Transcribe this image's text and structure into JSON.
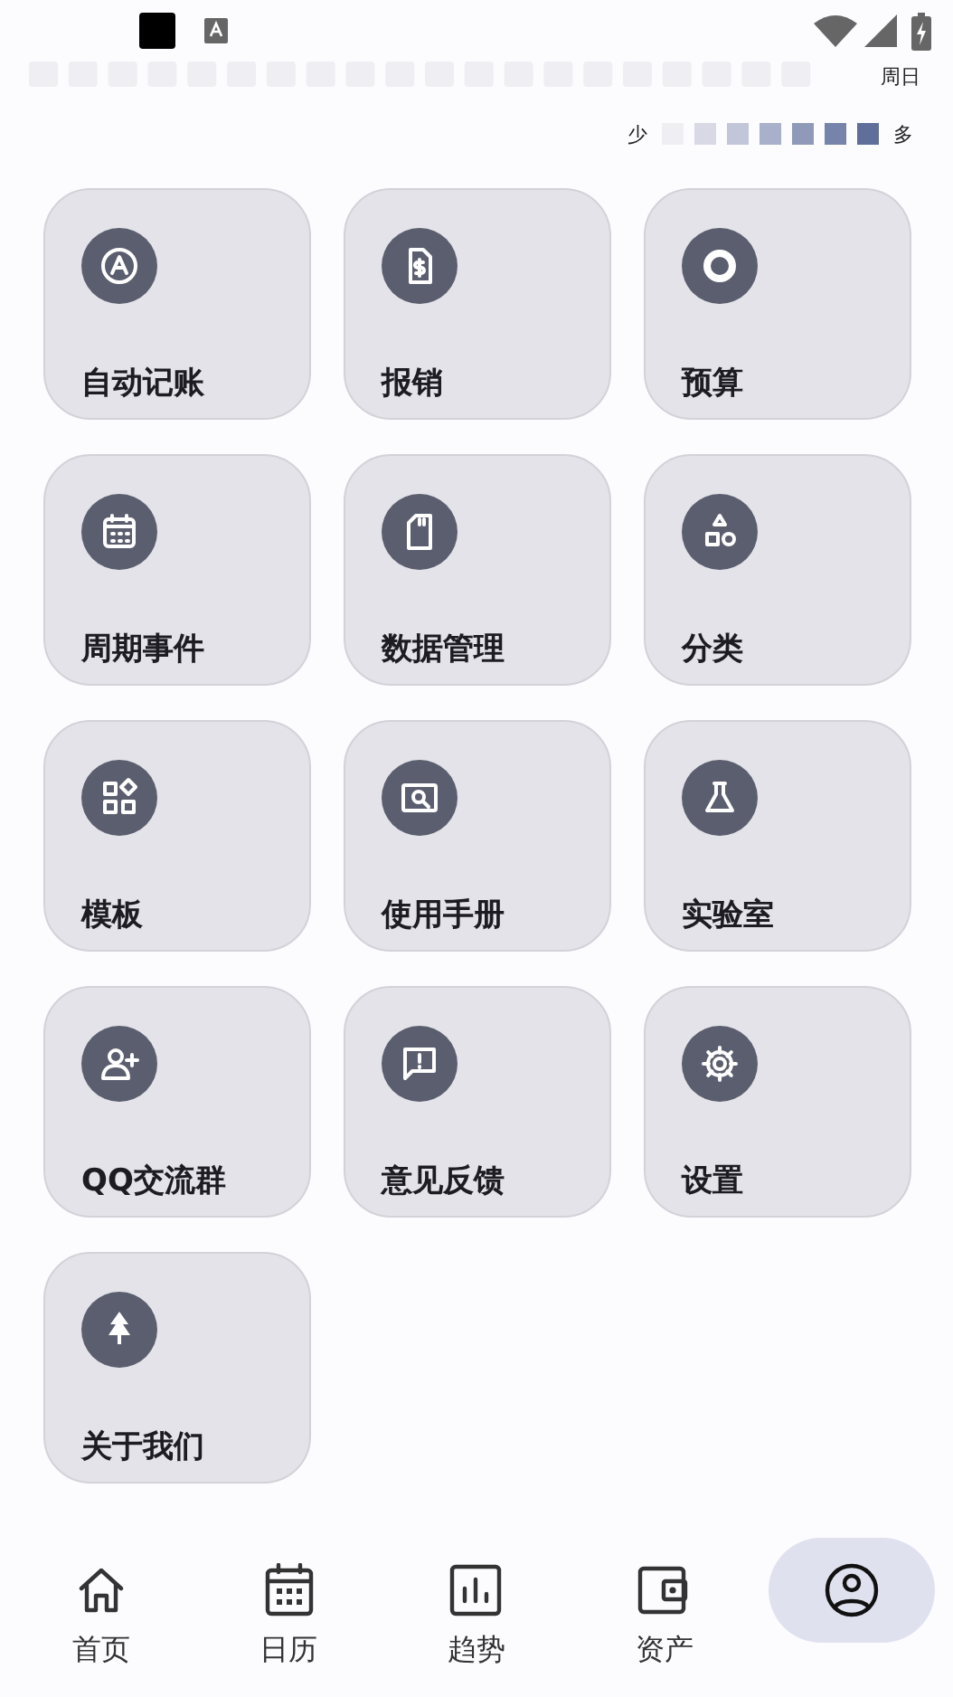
{
  "heatmap": {
    "day_label": "周日",
    "legend": {
      "less": "少",
      "more": "多",
      "swatches": [
        {
          "color": "#efeff3"
        },
        {
          "color": "#d8d9e5"
        },
        {
          "color": "#c1c6d9"
        },
        {
          "color": "#a8b0ca"
        },
        {
          "color": "#8f9abb"
        },
        {
          "color": "#7684ab"
        },
        {
          "color": "#5f6f9a"
        }
      ]
    }
  },
  "menu": [
    {
      "label": "自动记账"
    },
    {
      "label": "报销"
    },
    {
      "label": "预算"
    },
    {
      "label": "周期事件"
    },
    {
      "label": "数据管理"
    },
    {
      "label": "分类"
    },
    {
      "label": "模板"
    },
    {
      "label": "使用手册"
    },
    {
      "label": "实验室"
    },
    {
      "label": "QQ交流群"
    },
    {
      "label": "意见反馈"
    },
    {
      "label": "设置"
    },
    {
      "label": "关于我们"
    }
  ],
  "nav": [
    {
      "label": "首页",
      "selected": false
    },
    {
      "label": "日历",
      "selected": false
    },
    {
      "label": "趋势",
      "selected": false
    },
    {
      "label": "资产",
      "selected": false
    },
    {
      "selected": true
    }
  ]
}
